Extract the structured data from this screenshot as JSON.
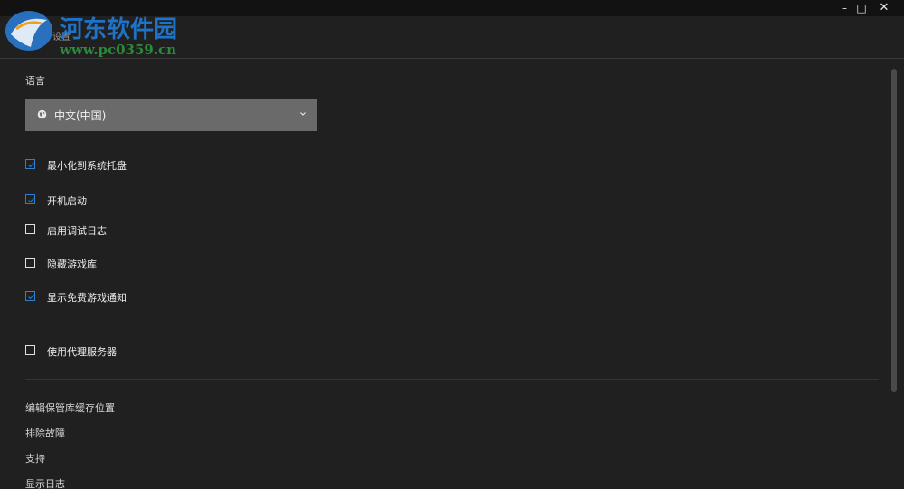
{
  "window": {
    "minimize": "–",
    "maximize": "□",
    "close": "✕"
  },
  "watermark": {
    "site_name": "河东软件园",
    "url": "www.pc0359.cn"
  },
  "header": {
    "title": "设置"
  },
  "language": {
    "label": "语言",
    "selected": "中文(中国)"
  },
  "options": [
    {
      "label": "最小化到系统托盘",
      "checked": true
    },
    {
      "label": "开机启动",
      "checked": true
    },
    {
      "label": "启用调试日志",
      "checked": false
    },
    {
      "label": "隐藏游戏库",
      "checked": false
    },
    {
      "label": "显示免费游戏通知",
      "checked": true
    }
  ],
  "proxy": {
    "label": "使用代理服务器",
    "checked": false
  },
  "links": {
    "edit_vault": "编辑保管库缓存位置",
    "troubleshoot": "排除故障",
    "support": "支持",
    "show_log": "显示日志"
  },
  "colors": {
    "accent": "#2f7fd0",
    "background": "#202020",
    "titlebar": "#121212",
    "dropdown": "#6a6a6a"
  },
  "icons": {
    "globe": "globe-icon",
    "chevron": "chevron-down-icon",
    "check": "check-icon"
  }
}
